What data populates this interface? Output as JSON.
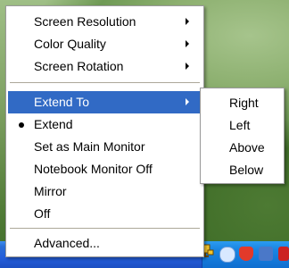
{
  "menu": {
    "items": [
      {
        "label": "Screen Resolution",
        "has_submenu": true
      },
      {
        "label": "Color Quality",
        "has_submenu": true
      },
      {
        "label": "Screen Rotation",
        "has_submenu": true
      },
      {
        "label": "Extend To",
        "has_submenu": true,
        "highlighted": true
      },
      {
        "label": "Extend",
        "checked": true
      },
      {
        "label": "Set as Main Monitor"
      },
      {
        "label": "Notebook Monitor Off"
      },
      {
        "label": "Mirror"
      },
      {
        "label": "Off"
      },
      {
        "label": "Advanced..."
      }
    ]
  },
  "submenu": {
    "items": [
      {
        "label": "Right"
      },
      {
        "label": "Left"
      },
      {
        "label": "Above"
      },
      {
        "label": "Below"
      }
    ]
  },
  "colors": {
    "highlight": "#316ac5",
    "taskbar": "#245edb",
    "tray": "#0f6ed0"
  },
  "icons": {
    "tray": [
      "monitor-icon",
      "network-icon",
      "security-shield-icon",
      "volume-icon",
      "alert-icon"
    ]
  }
}
